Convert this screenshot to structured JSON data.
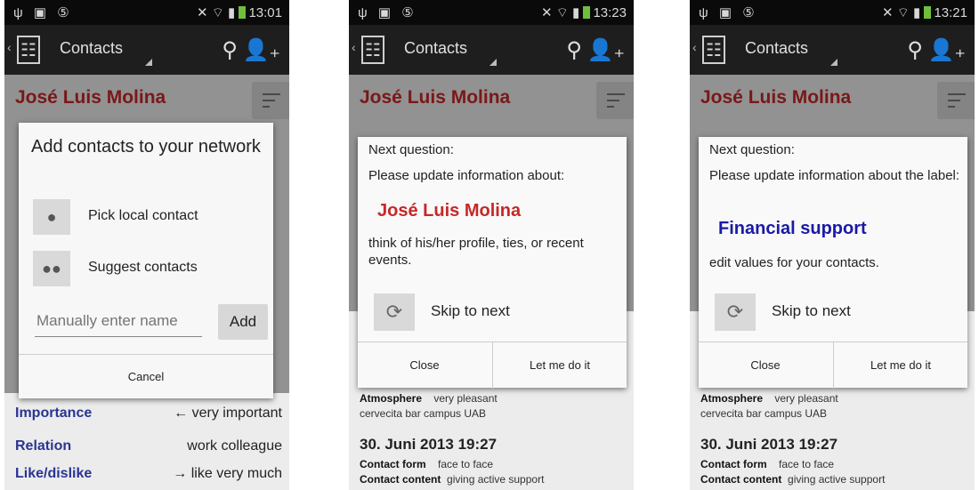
{
  "statusbar": {
    "left_icons": "ψ ▣ ⑤",
    "right_icons": "✕ ⌔ ▮",
    "times": [
      "13:01",
      "13:23",
      "13:21"
    ]
  },
  "actionbar": {
    "title": "Contacts",
    "back_glyph": "‹",
    "logo_glyph": "☷",
    "search_glyph": "⚲",
    "add_contact_glyph": "👤₊"
  },
  "contact": {
    "name": "José Luis Molina"
  },
  "phone1": {
    "dialog": {
      "title": "Add contacts to your network",
      "options": [
        {
          "label": "Pick local contact",
          "icon": "person-icon"
        },
        {
          "label": "Suggest contacts",
          "icon": "group-icon"
        }
      ],
      "name_placeholder": "Manually enter name",
      "add_label": "Add",
      "cancel_label": "Cancel"
    },
    "bg_rows": [
      {
        "label": "Importance",
        "value": "very important",
        "arrow": "←"
      },
      {
        "label": "Relation",
        "value": "work colleague",
        "arrow": ""
      },
      {
        "label": "Like/dislike",
        "value": "like very much",
        "arrow": "→"
      }
    ]
  },
  "phone2": {
    "dialog": {
      "header": "Next question:",
      "ask": "Please update information about:",
      "focus": "José Luis Molina",
      "hint": "think of his/her profile, ties, or recent events.",
      "skip_label": "Skip to next",
      "close_label": "Close",
      "doit_label": "Let me do it"
    }
  },
  "phone3": {
    "dialog": {
      "header": "Next question:",
      "ask": "Please update information about the label:",
      "focus": "Financial support",
      "hint": "edit values for your contacts.",
      "skip_label": "Skip to next",
      "close_label": "Close",
      "doit_label": "Let me do it"
    }
  },
  "event_below": {
    "atmosphere_key": "Atmosphere",
    "atmosphere_val": "very pleasant",
    "place": "cervecita bar campus UAB",
    "date": "30. Juni 2013  19:27",
    "form_key": "Contact form",
    "form_val": "face to face",
    "content_key": "Contact content",
    "content_val": "giving active support"
  },
  "colors": {
    "name_red": "#c62828",
    "label_blue": "#283593",
    "focus_blue": "#1a1aa6"
  }
}
